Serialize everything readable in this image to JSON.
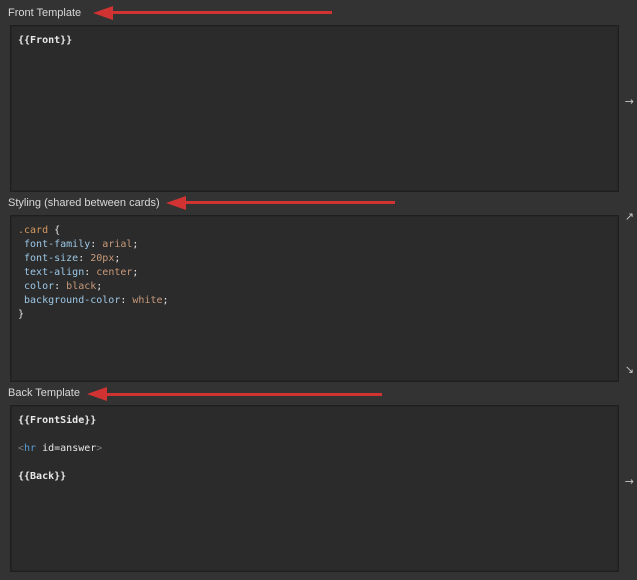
{
  "front_template": {
    "label": "Front Template",
    "code": {
      "line1": "{{Front}}"
    },
    "side_glyph": "→"
  },
  "styling": {
    "label": "Styling (shared between cards)",
    "code": {
      "selector": ".card",
      "open_brace": " {",
      "prop1": " font-family",
      "val1": "arial",
      "prop2": " font-size",
      "val2": "20px",
      "prop3": " text-align",
      "val3": "center",
      "prop4": " color",
      "val4": "black",
      "prop5": " background-color",
      "val5": "white",
      "colon": ": ",
      "semicolon": ";",
      "close_brace": "}"
    },
    "side_glyph_top": "↗",
    "side_glyph_bottom": "↘"
  },
  "back_template": {
    "label": "Back Template",
    "code": {
      "line1": "{{FrontSide}}",
      "hr_open": "<",
      "hr_tag": "hr",
      "hr_attr": " id=answer",
      "hr_close": ">",
      "line3": "{{Back}}"
    },
    "side_glyph": "→"
  },
  "colors": {
    "background": "#333333",
    "panel": "#2b2b2b",
    "label_text": "#d8d8d8",
    "code_text": "#e8e8e8",
    "css_selector": "#d69a5e",
    "css_property": "#9cc7e6",
    "css_value": "#c99a7a",
    "html_bracket": "#7a7a7a",
    "html_tag": "#5a9bd6",
    "annotation_arrow": "#d13232"
  }
}
